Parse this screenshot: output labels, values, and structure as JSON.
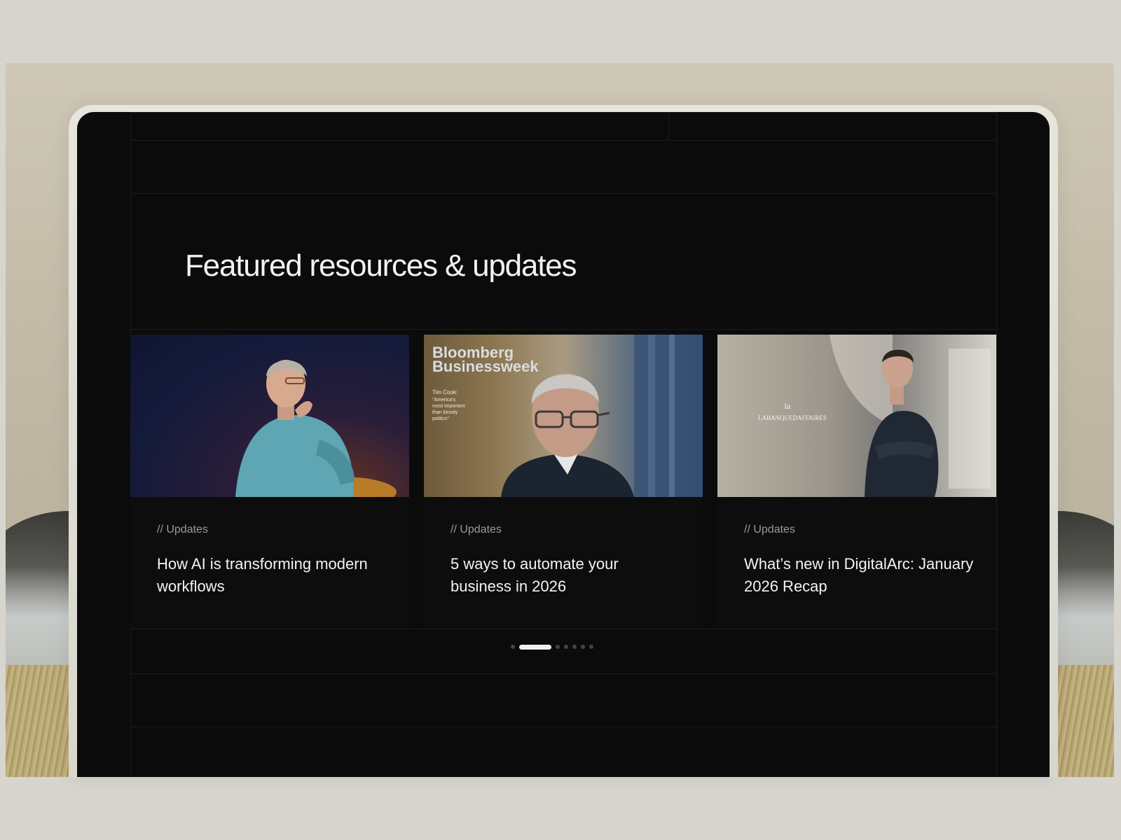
{
  "section": {
    "title": "Featured resources & updates"
  },
  "cards": [
    {
      "category": "// Updates",
      "title": "How AI is transforming modern workflows",
      "image": "man-in-blue-sweater-seated"
    },
    {
      "category": "// Updates",
      "title": "5 ways to automate your business in 2026",
      "image": "bloomberg-businessweek-cover",
      "image_text": {
        "masthead_line1": "Bloomberg",
        "masthead_line2": "Businessweek",
        "cover_line1": "Tim Cook:",
        "cover_line2": "\"America's",
        "cover_line3": "most important",
        "cover_line4": "than bloody",
        "cover_line5": "politics\""
      }
    },
    {
      "category": "// Updates",
      "title": "What’s new in DigitalArc: January 2026 Recap",
      "image": "man-with-arms-crossed",
      "image_text": {
        "logo_mark": "la",
        "logo_name": "LABANQUEDAFFAIRES"
      }
    }
  ],
  "carousel": {
    "total": 7,
    "active_index": 1
  }
}
